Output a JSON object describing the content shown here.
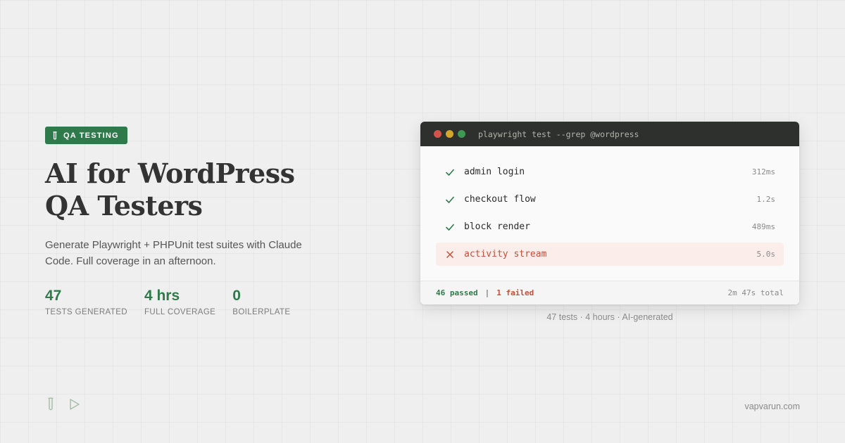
{
  "hero": {
    "badge": "QA TESTING",
    "badge_icon": "test-tube-icon",
    "title_line1": "AI for WordPress",
    "title_line2": "QA Testers",
    "subtitle": "Generate Playwright + PHPUnit test suites with Claude Code. Full coverage in an afternoon.",
    "stats": [
      {
        "value": "47",
        "label": "TESTS GENERATED"
      },
      {
        "value": "4 hrs",
        "label": "FULL COVERAGE"
      },
      {
        "value": "0",
        "label": "BOILERPLATE"
      }
    ]
  },
  "terminal": {
    "command": "playwright test --grep @wordpress",
    "tests": [
      {
        "name": "admin login",
        "time": "312ms",
        "status": "pass"
      },
      {
        "name": "checkout flow",
        "time": "1.2s",
        "status": "pass"
      },
      {
        "name": "block render",
        "time": "489ms",
        "status": "pass"
      },
      {
        "name": "activity stream",
        "time": "5.0s",
        "status": "fail"
      }
    ],
    "summary": {
      "passed": "46 passed",
      "separator": "|",
      "failed": "1 failed",
      "total": "2m 47s total"
    }
  },
  "caption": "47 tests · 4 hours · AI-generated",
  "footer": {
    "icons": [
      "test-tube-icon",
      "play-icon"
    ],
    "site": "vapvarun.com"
  },
  "colors": {
    "accent": "#2e7a4a",
    "fail": "#c0503c",
    "terminal_bar": "#2d302c"
  }
}
